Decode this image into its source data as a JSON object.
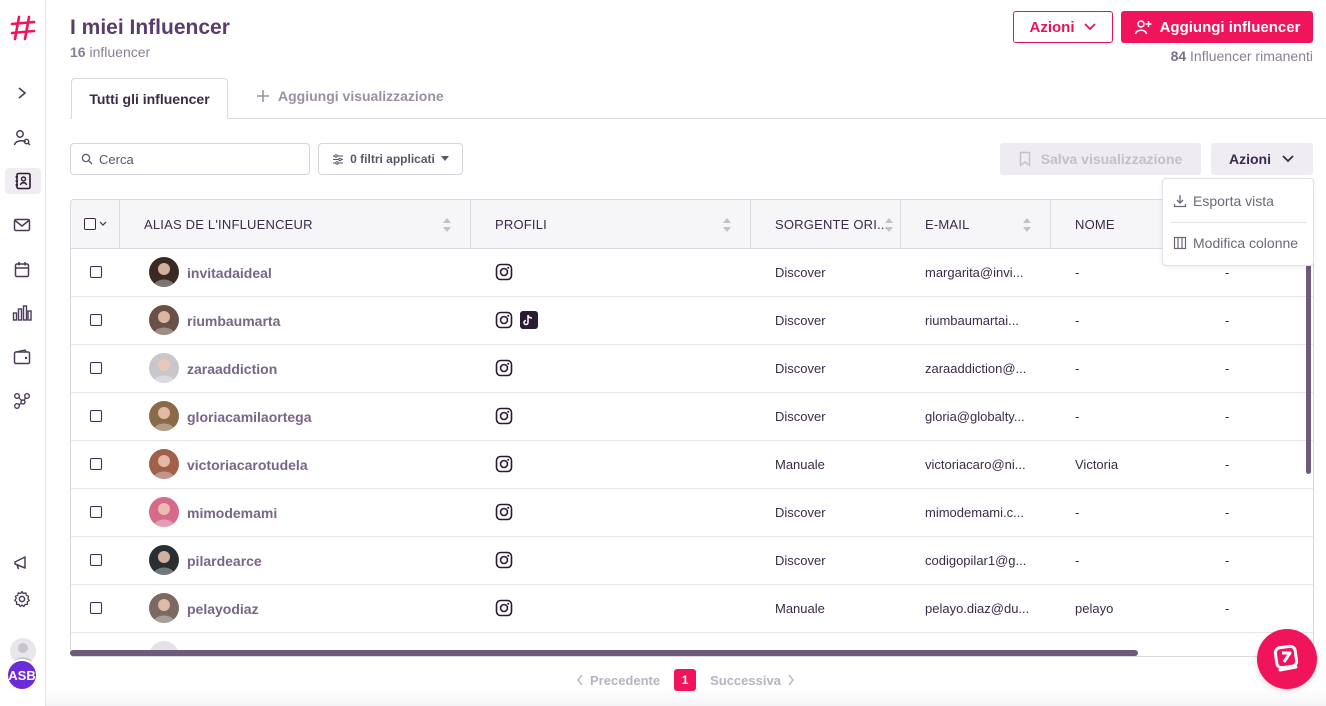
{
  "header": {
    "title": "I miei Influencer",
    "count": "16",
    "count_label": "influencer",
    "actions_label": "Azioni",
    "add_label": "Aggiungi influencer",
    "remaining_count": "84",
    "remaining_label": "Influencer rimanenti"
  },
  "tabs": {
    "active": "Tutti gli influencer",
    "add": "Aggiungi visualizzazione"
  },
  "toolbar": {
    "search_placeholder": "Cerca",
    "filters_label": "0 filtri applicati",
    "save_view_label": "Salva visualizzazione",
    "actions_label": "Azioni"
  },
  "menu": {
    "items": [
      "Esporta vista",
      "Modifica colonne"
    ]
  },
  "table": {
    "columns": [
      "ALIAS DE L'INFLUENCEUR",
      "PROFILI",
      "SORGENTE ORI...",
      "E-MAIL",
      "NOME"
    ],
    "rows": [
      {
        "alias": "invitadaideal",
        "profiles": [
          "instagram"
        ],
        "source": "Discover",
        "email": "margarita@invi...",
        "name": "-",
        "extra": "-",
        "avatar_color": "#3a2a25"
      },
      {
        "alias": "riumbaumarta",
        "profiles": [
          "instagram",
          "tiktok"
        ],
        "source": "Discover",
        "email": "riumbaumartai...",
        "name": "-",
        "extra": "-",
        "avatar_color": "#6b5048"
      },
      {
        "alias": "zaraaddiction",
        "profiles": [
          "instagram"
        ],
        "source": "Discover",
        "email": "zaraaddiction@...",
        "name": "-",
        "extra": "-",
        "avatar_color": "#c9c7cc"
      },
      {
        "alias": "gloriacamilaortega",
        "profiles": [
          "instagram"
        ],
        "source": "Discover",
        "email": "gloria@globalty...",
        "name": "-",
        "extra": "-",
        "avatar_color": "#8a6a48"
      },
      {
        "alias": "victoriacarotudela",
        "profiles": [
          "instagram"
        ],
        "source": "Manuale",
        "email": "victoriacaro@ni...",
        "name": "Victoria",
        "extra": "-",
        "avatar_color": "#a0604a"
      },
      {
        "alias": "mimodemami",
        "profiles": [
          "instagram"
        ],
        "source": "Discover",
        "email": "mimodemami.c...",
        "name": "-",
        "extra": "-",
        "avatar_color": "#d66a8a"
      },
      {
        "alias": "pilardearce",
        "profiles": [
          "instagram"
        ],
        "source": "Discover",
        "email": "codigopilar1@g...",
        "name": "-",
        "extra": "-",
        "avatar_color": "#2a2f33"
      },
      {
        "alias": "pelayodiaz",
        "profiles": [
          "instagram"
        ],
        "source": "Manuale",
        "email": "pelayo.diaz@du...",
        "name": "pelayo",
        "extra": "-",
        "avatar_color": "#7a6a62"
      }
    ]
  },
  "pagination": {
    "prev": "Precedente",
    "current": "1",
    "next": "Successiva"
  },
  "user": {
    "initials": "ASB"
  },
  "colors": {
    "brand": "#f0145a",
    "primary_text": "#5b3d6b",
    "avatar": "#6b2bd6"
  }
}
